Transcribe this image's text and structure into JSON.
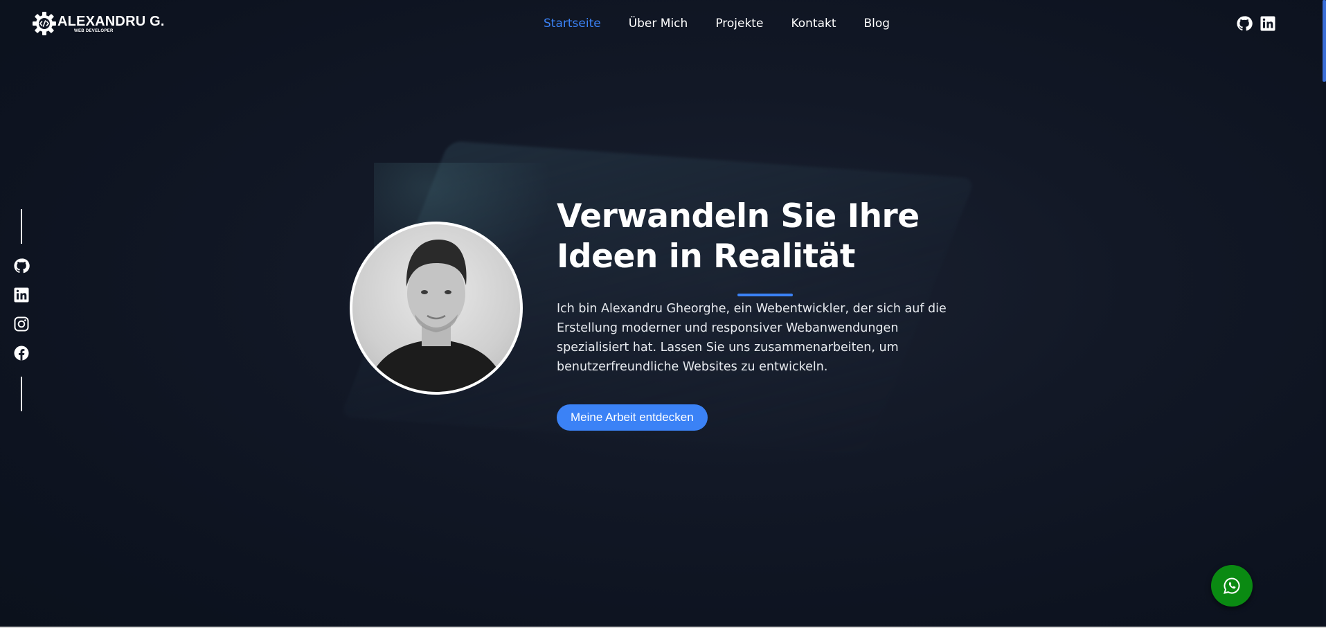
{
  "logo": {
    "name": "ALEXANDRU G.",
    "subtitle": "WEB DEVELOPER"
  },
  "nav": {
    "items": [
      {
        "label": "Startseite",
        "active": true
      },
      {
        "label": "Über Mich",
        "active": false
      },
      {
        "label": "Projekte",
        "active": false
      },
      {
        "label": "Kontakt",
        "active": false
      },
      {
        "label": "Blog",
        "active": false
      }
    ]
  },
  "header_social": [
    "github-icon",
    "linkedin-icon"
  ],
  "side_social": [
    "github-icon",
    "linkedin-icon",
    "instagram-icon",
    "facebook-icon"
  ],
  "hero": {
    "title_line1": "Verwandeln Sie Ihre",
    "title_line2": "Ideen in Realität",
    "description": "Ich bin Alexandru Gheorghe, ein Webentwickler, der sich auf die Erstellung moderner und responsiver Webanwendungen spezialisiert hat. Lassen Sie uns zusammenarbeiten, um benutzerfreundliche Websites zu entwickeln.",
    "cta_label": "Meine Arbeit entdecken"
  },
  "floating": {
    "icon": "whatsapp-icon"
  },
  "colors": {
    "accent": "#3b82f6",
    "background": "#121826",
    "whatsapp": "#0a8a12"
  }
}
